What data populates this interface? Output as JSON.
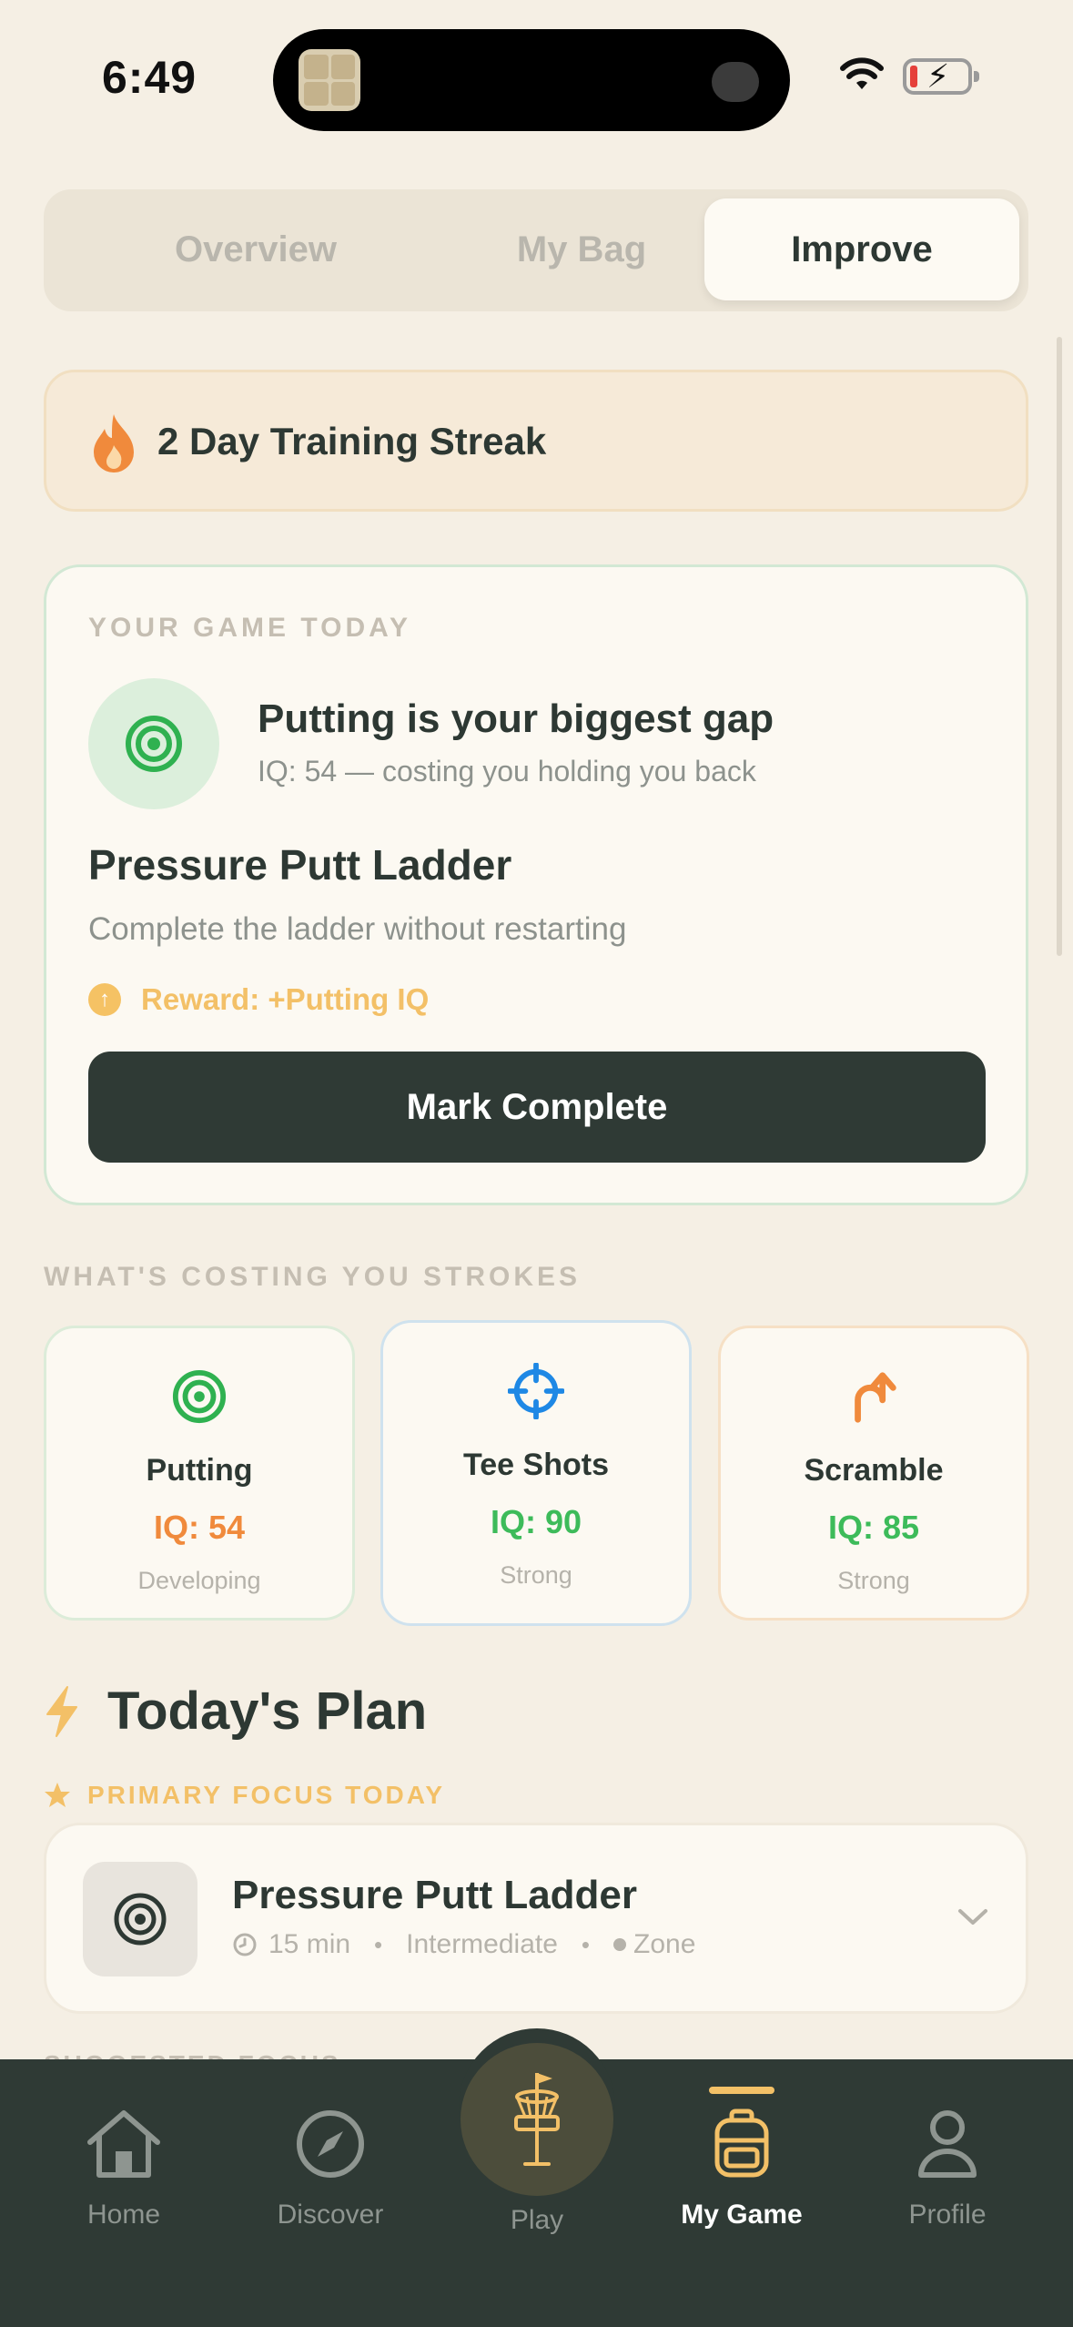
{
  "status_bar": {
    "time": "6:49"
  },
  "segmented": {
    "tabs": [
      "Overview",
      "My Bag",
      "Improve"
    ],
    "selected": "Improve"
  },
  "streak": {
    "text": "2 Day Training Streak",
    "icon": "flame-icon"
  },
  "game_today": {
    "eyebrow": "YOUR GAME TODAY",
    "gap_title": "Putting is your biggest gap",
    "gap_subtitle": "IQ: 54 — costing you holding you back",
    "drill_title": "Pressure Putt Ladder",
    "drill_description": "Complete the ladder without restarting",
    "reward": "Reward: +Putting IQ",
    "button": "Mark Complete"
  },
  "costing": {
    "eyebrow": "WHAT'S COSTING YOU STROKES",
    "cards": [
      {
        "label": "Putting",
        "iq": "IQ: 54",
        "status": "Developing",
        "icon": "target-icon",
        "color": "#f08a3c"
      },
      {
        "label": "Tee Shots",
        "iq": "IQ: 90",
        "status": "Strong",
        "icon": "crosshair-icon",
        "color": "#3dbb5a"
      },
      {
        "label": "Scramble",
        "iq": "IQ: 85",
        "status": "Strong",
        "icon": "turn-up-arrow-icon",
        "color": "#3dbb5a"
      }
    ]
  },
  "plan": {
    "title": "Today's Plan",
    "focus_label": "PRIMARY FOCUS TODAY",
    "item": {
      "name": "Pressure Putt Ladder",
      "duration": "15 min",
      "level": "Intermediate",
      "type": "Zone"
    },
    "next_section_peek": "SUGGESTED FOCUS"
  },
  "tabbar": {
    "tabs": [
      {
        "label": "Home",
        "icon": "home-icon"
      },
      {
        "label": "Discover",
        "icon": "compass-icon"
      },
      {
        "label": "Play",
        "icon": "disc-golf-basket-icon"
      },
      {
        "label": "My Game",
        "icon": "backpack-icon"
      },
      {
        "label": "Profile",
        "icon": "person-icon"
      }
    ],
    "active": "My Game"
  },
  "colors": {
    "background": "#f5efe4",
    "dark": "#2f3a35",
    "accent_gold": "#f3c067",
    "green": "#3dbb5a",
    "orange": "#f08a3c",
    "blue": "#1e88e5"
  }
}
